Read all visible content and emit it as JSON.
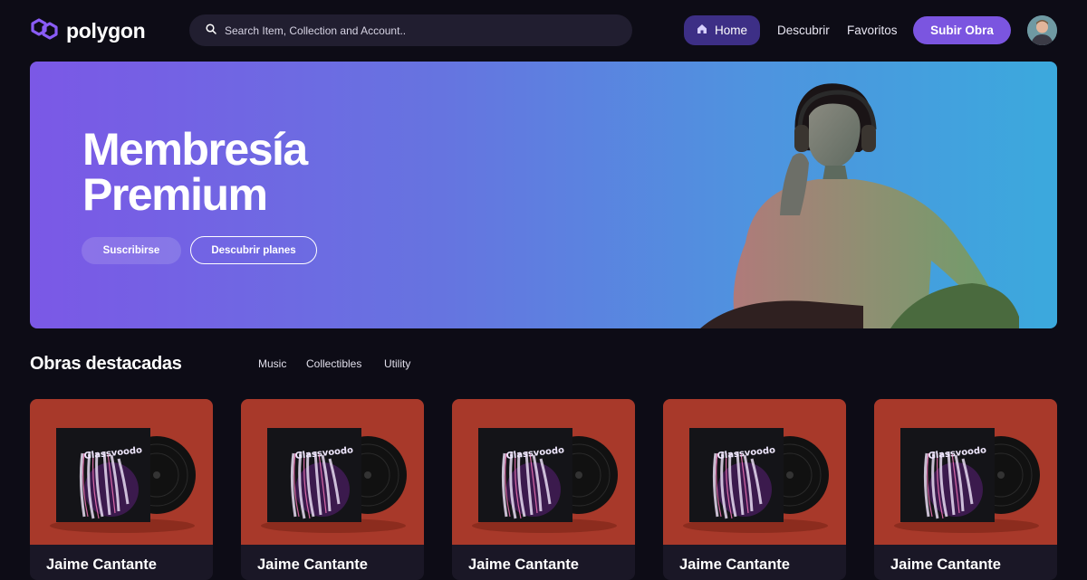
{
  "app": {
    "name": "polygon"
  },
  "search": {
    "placeholder": "Search Item, Collection and Account.."
  },
  "nav": {
    "home_label": "Home",
    "discover_label": "Descubrir",
    "favorites_label": "Favoritos",
    "upload_label": "Subir Obra"
  },
  "hero": {
    "title_line1": "Membresía",
    "title_line2": "Premium",
    "subscribe_label": "Suscribirse",
    "plans_label": "Descubrir planes"
  },
  "featured": {
    "title": "Obras destacadas",
    "filters": [
      "Music",
      "Collectibles",
      "Utility"
    ],
    "cards": [
      {
        "title": "Jaime Cantante",
        "album": "Glassvoodo"
      },
      {
        "title": "Jaime Cantante",
        "album": "Glassvoodo"
      },
      {
        "title": "Jaime Cantante",
        "album": "Glassvoodo"
      },
      {
        "title": "Jaime Cantante",
        "album": "Glassvoodo"
      },
      {
        "title": "Jaime Cantante",
        "album": "Glassvoodo"
      }
    ]
  },
  "icons": {
    "logo": "polygon-logo-icon",
    "search": "search-icon",
    "home": "home-icon",
    "avatar": "user-avatar"
  },
  "colors": {
    "background": "#0d0c16",
    "accent": "#7b55e0",
    "home_pill": "#3d2f86",
    "card_art": "#a8392a",
    "hero_start": "#7b58e6",
    "hero_end": "#3ba9dd"
  }
}
